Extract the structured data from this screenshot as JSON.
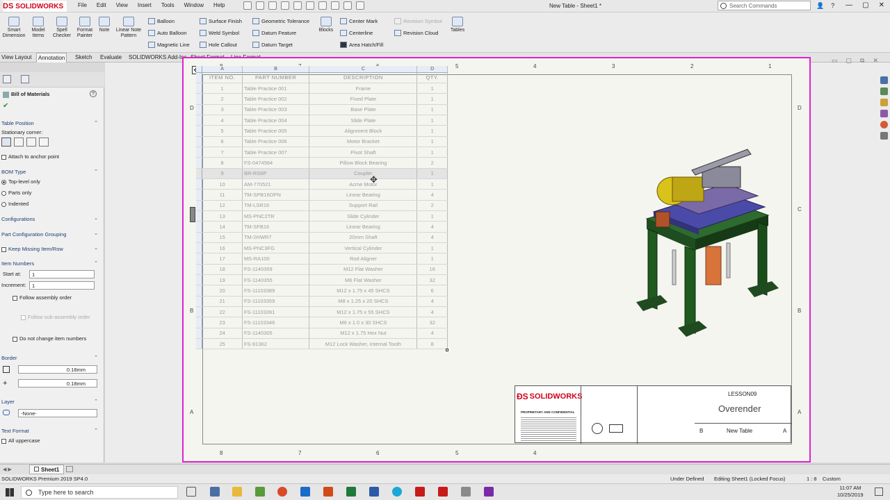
{
  "app": {
    "logo_ds": "DS",
    "logo_name": "SOLIDWORKS",
    "window_title": "New Table - Sheet1 *"
  },
  "menu": [
    "File",
    "Edit",
    "View",
    "Insert",
    "Tools",
    "Window",
    "Help"
  ],
  "search": {
    "placeholder": "Search Commands"
  },
  "ribbon": {
    "smart_dimension": "Smart Dimension",
    "model_items": "Model Items",
    "spell_checker": "Spell Checker",
    "format_painter": "Format Painter",
    "note": "Note",
    "linear_note_pattern": "Linear Note Pattern",
    "balloon": "Balloon",
    "auto_balloon": "Auto Balloon",
    "magnetic_line": "Magnetic Line",
    "surface_finish": "Surface Finish",
    "weld_symbol": "Weld Symbol",
    "hole_callout": "Hole Callout",
    "geometric_tolerance": "Geometric Tolerance",
    "datum_feature": "Datum Feature",
    "datum_target": "Datum Target",
    "blocks": "Blocks",
    "center_mark": "Center Mark",
    "centerline": "Centerline",
    "area_hatch": "Area Hatch/Fill",
    "revision_symbol": "Revision Symbol",
    "revision_cloud": "Revision Cloud",
    "tables": "Tables"
  },
  "tabs": [
    "View Layout",
    "Annotation",
    "Sketch",
    "Evaluate",
    "SOLIDWORKS Add-Ins",
    "Sheet Format",
    "Line Format"
  ],
  "panel": {
    "title": "Bill of Materials",
    "table_position": "Table Position",
    "stationary_corner": "Stationary corner:",
    "attach_anchor": "Attach to anchor point",
    "bom_type": "BOM Type",
    "top_level": "Top-level only",
    "parts_only": "Parts only",
    "indented": "Indented",
    "configurations": "Configurations",
    "part_config_grouping": "Part Configuration Grouping",
    "keep_missing": "Keep Missing Item/Row",
    "item_numbers": "Item Numbers",
    "start_at_label": "Start at:",
    "start_at": "1",
    "increment_label": "Increment:",
    "increment": "1",
    "follow_assembly": "Follow assembly order",
    "follow_sub": "Follow sub-assembly order",
    "do_not_change": "Do not change item numbers",
    "border": "Border",
    "border1": "0.18mm",
    "border2": "0.18mm",
    "layer": "Layer",
    "layer_value": "-None-",
    "text_format": "Text Format",
    "all_uppercase": "All uppercase"
  },
  "sheet_zones": {
    "top": [
      "8",
      "7",
      "6",
      "5",
      "4",
      "3",
      "2",
      "1"
    ],
    "side": [
      "D",
      "C",
      "B",
      "A"
    ]
  },
  "bom": {
    "col_letters": [
      "A",
      "B",
      "C",
      "D"
    ],
    "headers": [
      "ITEM NO.",
      "PART NUMBER",
      "DESCRIPTION",
      "QTY."
    ],
    "rows": [
      [
        "1",
        "Table Practice 001",
        "Frame",
        "1"
      ],
      [
        "2",
        "Table Practice 002",
        "Fixed Plate",
        "1"
      ],
      [
        "3",
        "Table Practice 003",
        "Base Plate",
        "1"
      ],
      [
        "4",
        "Table Practice 004",
        "Slide Plate",
        "1"
      ],
      [
        "5",
        "Table Practice 005",
        "Alignment Block",
        "1"
      ],
      [
        "6",
        "Table Practice 006",
        "Motor Bracket",
        "1"
      ],
      [
        "7",
        "Table Practice 007",
        "Pivot Shaft",
        "1"
      ],
      [
        "8",
        "FS-0474584",
        "Pillow Block Bearing",
        "2"
      ],
      [
        "9",
        "BR-RS6P",
        "Coupler",
        "1"
      ],
      [
        "10",
        "AM-770521",
        "Acme Motor",
        "1"
      ],
      [
        "11",
        "TM-SPB16OPN",
        "Linear Bearing",
        "4"
      ],
      [
        "12",
        "TM-LSR16",
        "Support Rail",
        "2"
      ],
      [
        "13",
        "MS-PNC2TR",
        "Slide Cylinder",
        "1"
      ],
      [
        "14",
        "TM-SFB16",
        "Linear Bearing",
        "4"
      ],
      [
        "15",
        "TM-2HWR7",
        "20mm Shaft",
        "4"
      ],
      [
        "16",
        "MS-PNC3FG",
        "Vertical Cylinder",
        "1"
      ],
      [
        "17",
        "MS-RA100",
        "Rod Aligner",
        "1"
      ],
      [
        "18",
        "FS-1140359",
        "M12 Flat Washer",
        "16"
      ],
      [
        "19",
        "FS-1140355",
        "M6 Flat Washer",
        "32"
      ],
      [
        "20",
        "FS-11103389",
        "M12 x 1.75 x 45 SHCS",
        "6"
      ],
      [
        "21",
        "FS-11103359",
        "M8 x 1.25 x 20 SHCS",
        "4"
      ],
      [
        "22",
        "FS-11103391",
        "M12 x 1.75 x 55 SHCS",
        "4"
      ],
      [
        "23",
        "FS-11103346",
        "M6 x 1.0 x 30 SHCS",
        "32"
      ],
      [
        "24",
        "FS-1140305",
        "M12 x 1.75 Hex Nut",
        "4"
      ],
      [
        "25",
        "FS-91362",
        "M12 Lock Washer, Internal Tooth",
        "8"
      ]
    ]
  },
  "titleblock": {
    "brand": "SOLIDWORKS",
    "tag": "PROPRIETARY AND CONFIDENTIAL",
    "dwg_name": "LESSON09",
    "title": "Overender",
    "size": "B",
    "dwg_no": "New Table",
    "rev": "A"
  },
  "sheet_tab": "Sheet1",
  "status": {
    "state": "Under Defined",
    "editing": "Editing Sheet1 (Locked Focus)",
    "scale": "1 : 8",
    "units": "Custom",
    "version": "SOLIDWORKS Premium 2019 SP4.0"
  },
  "taskbar": {
    "search": "Type here to search",
    "time": "11:07 AM",
    "date": "10/25/2019"
  },
  "colors": {
    "sheet_border": "#e020d0",
    "frame": "#1f5c1f",
    "motor": "#d9c21a",
    "brand": "#d0021b"
  }
}
